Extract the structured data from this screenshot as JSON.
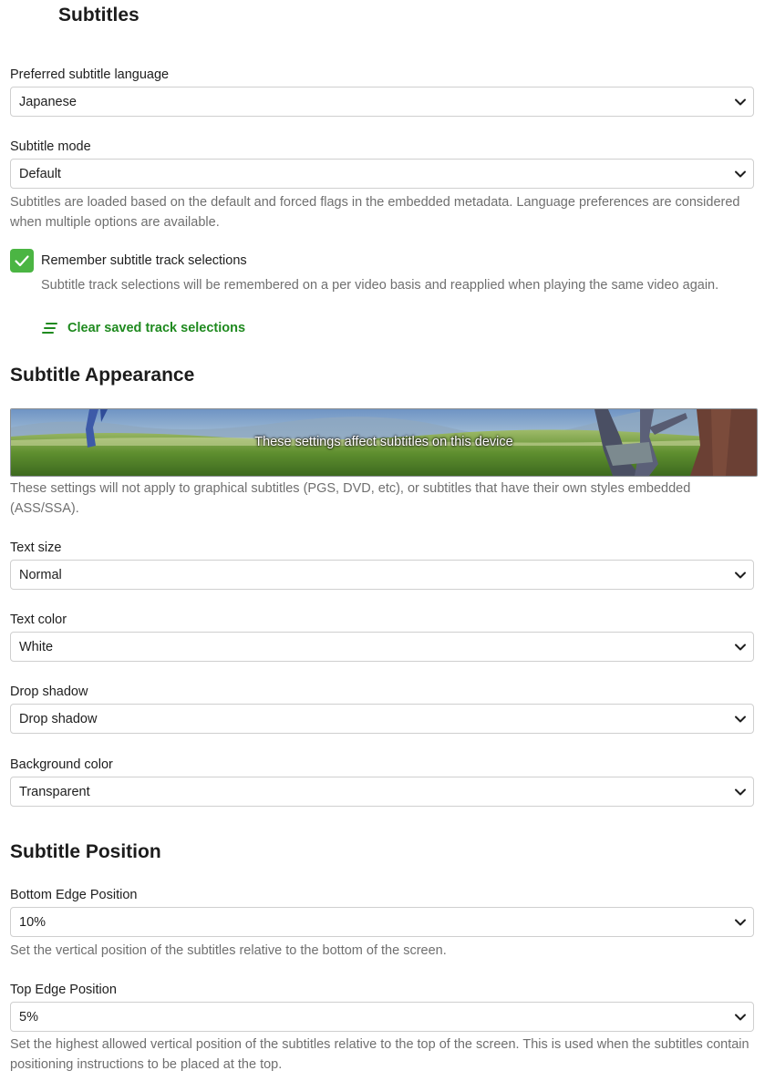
{
  "page": {
    "title": "Subtitles"
  },
  "preferred_language": {
    "label": "Preferred subtitle language",
    "value": "Japanese"
  },
  "subtitle_mode": {
    "label": "Subtitle mode",
    "value": "Default",
    "help": "Subtitles are loaded based on the default and forced flags in the embedded metadata. Language preferences are considered when multiple options are available."
  },
  "remember_tracks": {
    "label": "Remember subtitle track selections",
    "checked": true,
    "help": "Subtitle track selections will be remembered on a per video basis and reapplied when playing the same video again.",
    "clear_label": "Clear saved track selections"
  },
  "appearance": {
    "title": "Subtitle Appearance",
    "preview_text": "These settings affect subtitles on this device",
    "help": "These settings will not apply to graphical subtitles (PGS, DVD, etc), or subtitles that have their own styles embedded (ASS/SSA).",
    "text_size": {
      "label": "Text size",
      "value": "Normal"
    },
    "text_color": {
      "label": "Text color",
      "value": "White"
    },
    "drop_shadow": {
      "label": "Drop shadow",
      "value": "Drop shadow"
    },
    "background_color": {
      "label": "Background color",
      "value": "Transparent"
    }
  },
  "position": {
    "title": "Subtitle Position",
    "bottom_edge": {
      "label": "Bottom Edge Position",
      "value": "10%",
      "help": "Set the vertical position of the subtitles relative to the bottom of the screen."
    },
    "top_edge": {
      "label": "Top Edge Position",
      "value": "5%",
      "help": "Set the highest allowed vertical position of the subtitles relative to the top of the screen. This is used when the subtitles contain positioning instructions to be placed at the top."
    }
  },
  "colors": {
    "accent": "#4bb543",
    "link": "#1f8a1f",
    "muted": "#6f6f6f"
  }
}
